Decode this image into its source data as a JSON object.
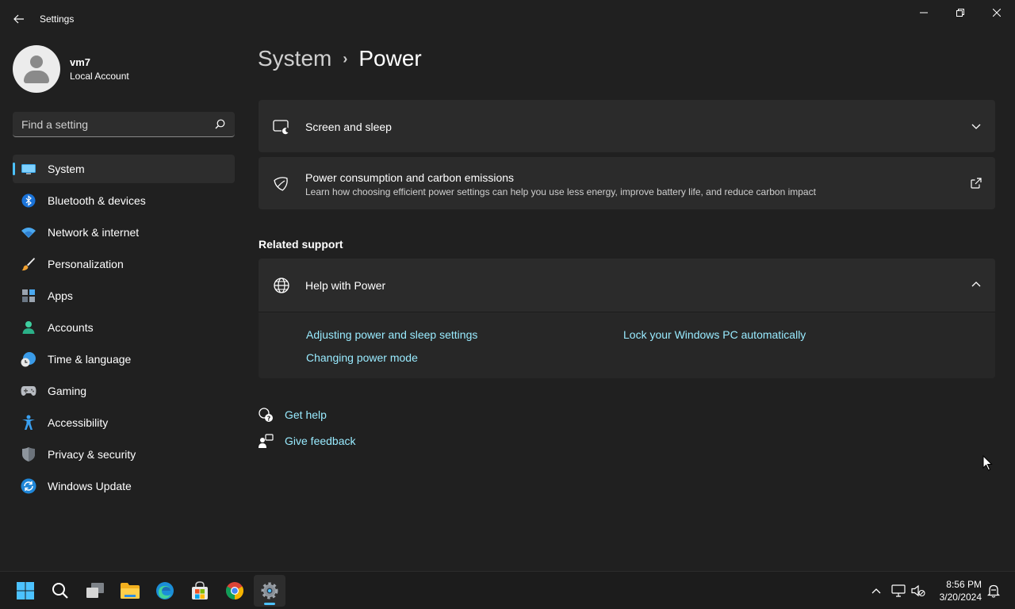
{
  "window": {
    "title": "Settings"
  },
  "profile": {
    "name": "vm7",
    "account_type": "Local Account"
  },
  "search": {
    "placeholder": "Find a setting"
  },
  "sidebar": {
    "items": [
      {
        "label": "System",
        "icon": "monitor-icon",
        "active": true
      },
      {
        "label": "Bluetooth & devices",
        "icon": "bluetooth-icon"
      },
      {
        "label": "Network & internet",
        "icon": "wifi-icon"
      },
      {
        "label": "Personalization",
        "icon": "brush-icon"
      },
      {
        "label": "Apps",
        "icon": "apps-icon"
      },
      {
        "label": "Accounts",
        "icon": "person-icon"
      },
      {
        "label": "Time & language",
        "icon": "globe-clock-icon"
      },
      {
        "label": "Gaming",
        "icon": "gamepad-icon"
      },
      {
        "label": "Accessibility",
        "icon": "accessibility-icon"
      },
      {
        "label": "Privacy & security",
        "icon": "shield-icon"
      },
      {
        "label": "Windows Update",
        "icon": "update-icon"
      }
    ]
  },
  "breadcrumb": {
    "parent": "System",
    "separator": "›",
    "current": "Power"
  },
  "cards": {
    "screen_sleep": {
      "title": "Screen and sleep"
    },
    "power_consumption": {
      "title": "Power consumption and carbon emissions",
      "subtitle": "Learn how choosing efficient power settings can help you use less energy, improve battery life, and reduce carbon impact"
    }
  },
  "related_support": {
    "heading": "Related support",
    "help": {
      "title": "Help with Power",
      "links": [
        "Adjusting power and sleep settings",
        "Changing power mode",
        "Lock your Windows PC automatically"
      ]
    }
  },
  "footer": {
    "get_help": "Get help",
    "give_feedback": "Give feedback"
  },
  "taskbar": {
    "time": "8:56 PM",
    "date": "3/20/2024"
  },
  "colors": {
    "accent": "#4cc2ff",
    "link": "#99ebff",
    "background": "#202020",
    "card": "#2b2b2b"
  }
}
